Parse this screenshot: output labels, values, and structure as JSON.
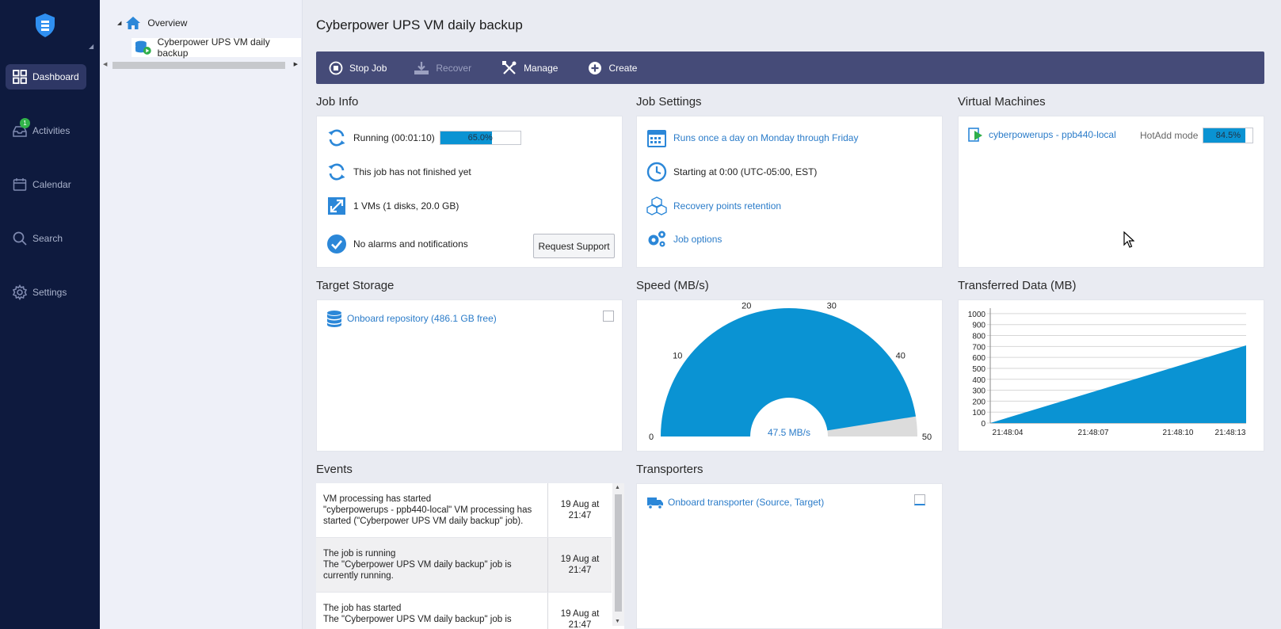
{
  "nav": {
    "items": [
      {
        "label": "Dashboard",
        "active": true
      },
      {
        "label": "Activities",
        "badge": "1"
      },
      {
        "label": "Calendar"
      },
      {
        "label": "Search"
      },
      {
        "label": "Settings"
      }
    ]
  },
  "tree": {
    "overview": "Overview",
    "job": "Cyberpower UPS VM daily backup"
  },
  "page": {
    "title": "Cyberpower UPS VM daily backup"
  },
  "toolbar": {
    "stop_job": "Stop Job",
    "recover": "Recover",
    "manage": "Manage",
    "create": "Create"
  },
  "job_info": {
    "title": "Job Info",
    "running": "Running (00:01:10)",
    "progress_label": "65.0%",
    "progress_fraction": 0.65,
    "not_finished": "This job has not finished yet",
    "vms": "1 VMs (1 disks, 20.0 GB)",
    "alarms": "No alarms and notifications",
    "request_support": "Request Support"
  },
  "job_settings": {
    "title": "Job Settings",
    "schedule": "Runs once a day on Monday through Friday",
    "start": "Starting at 0:00 (UTC-05:00, EST)",
    "retention": "Recovery points retention",
    "options": "Job options"
  },
  "virtual_machines": {
    "title": "Virtual Machines",
    "vm_name": "cyberpowerups - ppb440-local",
    "mode": "HotAdd mode",
    "progress_label": "84.5%",
    "progress_fraction": 0.845
  },
  "target_storage": {
    "title": "Target Storage",
    "repo": "Onboard repository (486.1 GB free)"
  },
  "speed": {
    "title": "Speed (MB/s)",
    "value_label": "47.5 MB/s",
    "value": 47.5,
    "max": 50,
    "ticks": [
      "0",
      "10",
      "20",
      "30",
      "40",
      "50"
    ]
  },
  "transferred": {
    "title": "Transferred Data (MB)"
  },
  "chart_data": {
    "type": "area",
    "title": "Transferred Data (MB)",
    "x": [
      "21:48:04",
      "21:48:13"
    ],
    "x_tick_labels": [
      "21:48:04",
      "21:48:07",
      "21:48:10",
      "21:48:13"
    ],
    "series": [
      {
        "values": [
          0,
          710
        ]
      }
    ],
    "y_ticks": [
      0,
      100,
      200,
      300,
      400,
      500,
      600,
      700,
      800,
      900,
      1000
    ],
    "ylim": [
      0,
      1050
    ],
    "grid": true,
    "color": "#0a93d3"
  },
  "events": {
    "title": "Events",
    "rows": [
      {
        "line1": "VM processing has started",
        "line2": "\"cyberpowerups - ppb440-local\" VM processing has started (\"Cyberpower UPS VM daily backup\" job).",
        "date1": "19 Aug at",
        "date2": "21:47"
      },
      {
        "line1": "The job is running",
        "line2": "The \"Cyberpower UPS VM daily backup\" job is currently running.",
        "date1": "19 Aug at",
        "date2": "21:47"
      },
      {
        "line1": "The job has started",
        "line2": "The \"Cyberpower UPS VM daily backup\" job is",
        "date1": "19 Aug at",
        "date2": "21:47"
      }
    ]
  },
  "transporters": {
    "title": "Transporters",
    "item": "Onboard transporter (Source, Target)"
  },
  "colors": {
    "nav_bg": "#0e1a3e",
    "toolbar_bg": "#454b78",
    "accent": "#0a93d3",
    "link": "#2b7cc9"
  }
}
